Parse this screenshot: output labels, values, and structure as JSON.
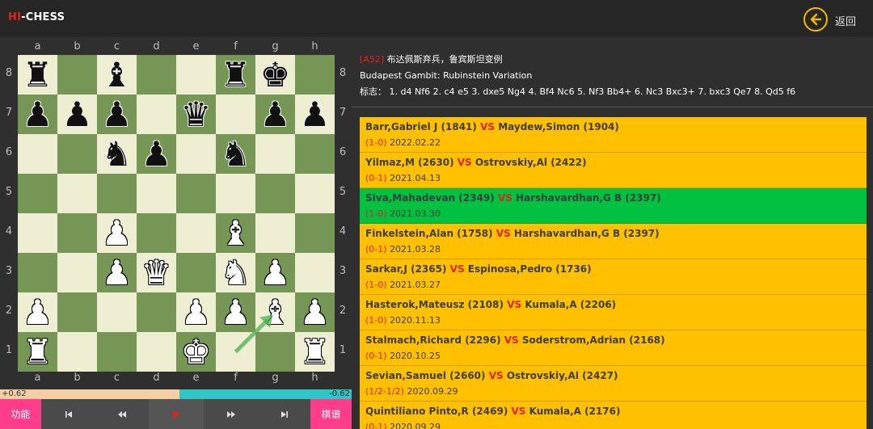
{
  "header": {
    "logo_hi": "HI",
    "logo_chess": "-CHESS",
    "back_label": "返回"
  },
  "board": {
    "files": [
      "a",
      "b",
      "c",
      "d",
      "e",
      "f",
      "g",
      "h"
    ],
    "ranks": [
      "8",
      "7",
      "6",
      "5",
      "4",
      "3",
      "2",
      "1"
    ],
    "position": [
      [
        "bR",
        "",
        "bB",
        "",
        "",
        "bR",
        "bK",
        ""
      ],
      [
        "bP",
        "bP",
        "bP",
        "",
        "bQ",
        "",
        "bP",
        "bP"
      ],
      [
        "",
        "",
        "bN",
        "bP",
        "",
        "bN",
        "",
        ""
      ],
      [
        "",
        "",
        "",
        "",
        "",
        "",
        "",
        ""
      ],
      [
        "",
        "",
        "wP",
        "",
        "",
        "wB",
        "",
        ""
      ],
      [
        "",
        "",
        "wP",
        "wQ",
        "",
        "wN",
        "wP",
        ""
      ],
      [
        "wP",
        "",
        "",
        "",
        "wP",
        "wP",
        "wB",
        "wP"
      ],
      [
        "wR",
        "",
        "",
        "",
        "wK",
        "",
        "",
        "wR"
      ]
    ],
    "last_move": {
      "from": "f1",
      "to": "g2",
      "color": "#4caf50"
    },
    "light_color": "#eeeed2",
    "dark_color": "#769656"
  },
  "eval": {
    "white_text": "+0.62",
    "black_text": "-0.62",
    "white_fraction": 0.51
  },
  "controls": {
    "function_label": "功能",
    "first_icon": "skip-to-start-icon",
    "prev_icon": "rewind-icon",
    "play_icon": "play-icon",
    "next_icon": "fast-forward-icon",
    "last_icon": "skip-to-end-icon",
    "lib_label": "棋谱"
  },
  "opening": {
    "code": "[A52]",
    "name_cn": "布达佩斯弃兵，鲁宾斯坦变例",
    "name_en": "Budapest Gambit: Rubinstein Variation",
    "moves_label": "标志：",
    "moves": "1. d4 Nf6 2. c4 e5 3. dxe5 Ng4 4. Bf4 Nc6 5. Nf3 Bb4+ 6. Nc3 Bxc3+ 7. bxc3 Qe7 8. Qd5 f6"
  },
  "games": [
    {
      "white": "Barr,Gabriel J (1841)",
      "vs": "VS",
      "black": "Maydew,Simon (1904)",
      "result": "(1-0)",
      "date": "2022.02.22",
      "selected": false
    },
    {
      "white": "Yilmaz,M (2630)",
      "vs": "VS",
      "black": "Ostrovskiy,Al (2422)",
      "result": "(0-1)",
      "date": "2021.04.13",
      "selected": false
    },
    {
      "white": "Siva,Mahadevan (2349)",
      "vs": "VS",
      "black": "Harshavardhan,G B (2397)",
      "result": "(1-0)",
      "date": "2021.03.30",
      "selected": true
    },
    {
      "white": "Finkelstein,Alan (1758)",
      "vs": "VS",
      "black": "Harshavardhan,G B (2397)",
      "result": "(0-1)",
      "date": "2021.03.28",
      "selected": false
    },
    {
      "white": "Sarkar,J (2365)",
      "vs": "VS",
      "black": "Espinosa,Pedro (1736)",
      "result": "(1-0)",
      "date": "2021.03.27",
      "selected": false
    },
    {
      "white": "Hasterok,Mateusz (2108)",
      "vs": "VS",
      "black": "Kumala,A (2206)",
      "result": "(1-0)",
      "date": "2020.11.13",
      "selected": false
    },
    {
      "white": "Stalmach,Richard (2296)",
      "vs": "VS",
      "black": "Soderstrom,Adrian (2168)",
      "result": "(0-1)",
      "date": "2020.10.25",
      "selected": false
    },
    {
      "white": "Sevian,Samuel (2660)",
      "vs": "VS",
      "black": "Ostrovskiy,Al (2427)",
      "result": "(1/2-1/2)",
      "date": "2020.09.29",
      "selected": false
    },
    {
      "white": "Quintiliano Pinto,R (2469)",
      "vs": "VS",
      "black": "Kumala,A (2176)",
      "result": "(0-1)",
      "date": "2020.09.29",
      "selected": false
    }
  ]
}
